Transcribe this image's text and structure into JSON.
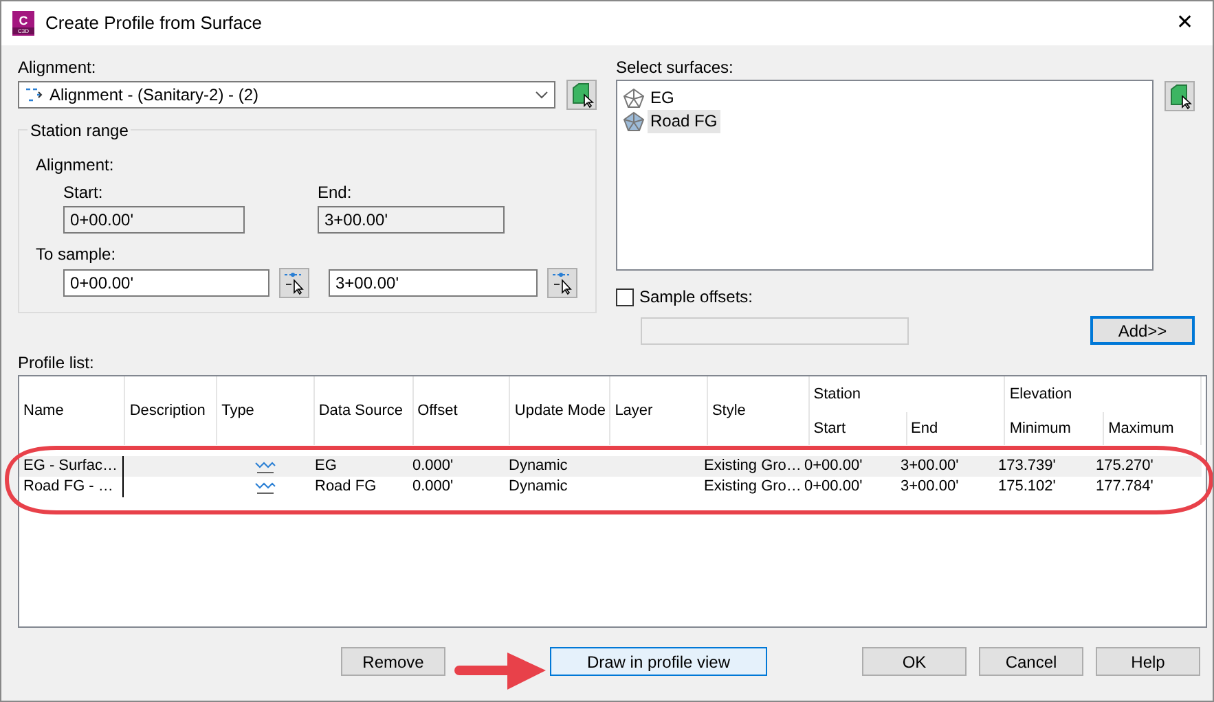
{
  "window": {
    "title": "Create Profile from Surface",
    "app_icon": {
      "letter": "C",
      "sub": "C3D"
    },
    "close": "✕"
  },
  "alignment": {
    "label": "Alignment:",
    "value": "Alignment - (Sanitary-2) - (2)"
  },
  "station_range": {
    "title": "Station range",
    "alignment_label": "Alignment:",
    "start_label": "Start:",
    "start": "0+00.00'",
    "end_label": "End:",
    "end": "3+00.00'",
    "sample_label": "To sample:",
    "sample_start": "0+00.00'",
    "sample_end": "3+00.00'"
  },
  "surfaces": {
    "label": "Select surfaces:",
    "items": [
      {
        "name": "EG",
        "selected": false
      },
      {
        "name": "Road FG",
        "selected": true
      }
    ]
  },
  "sample_offsets": {
    "label": "Sample offsets:",
    "checked": false
  },
  "add_button": {
    "label": "Add>>",
    "focused": true
  },
  "profile_list": {
    "label": "Profile list:",
    "columns": [
      "Name",
      "Description",
      "Type",
      "Data Source",
      "Offset",
      "Update Mode",
      "Layer",
      "Style"
    ],
    "groups": [
      {
        "label": "Station",
        "columns": [
          "Start",
          "End"
        ]
      },
      {
        "label": "Elevation",
        "columns": [
          "Minimum",
          "Maximum"
        ]
      }
    ],
    "rows": [
      {
        "selected": true,
        "cells": [
          "EG - Surfac…",
          "",
          "",
          "EG",
          "0.000'",
          "Dynamic",
          "",
          "Existing Gro…",
          "0+00.00'",
          "3+00.00'",
          "173.739'",
          "175.270'"
        ]
      },
      {
        "selected": false,
        "cells": [
          "Road FG - …",
          "",
          "",
          "Road FG",
          "0.000'",
          "Dynamic",
          "",
          "Existing Gro…",
          "0+00.00'",
          "3+00.00'",
          "175.102'",
          "177.784'"
        ]
      }
    ]
  },
  "buttons": [
    {
      "label": "Remove",
      "focused": false
    },
    {
      "label": "Draw in profile view",
      "focused": true
    },
    {
      "label": "OK",
      "focused": false
    },
    {
      "label": "Cancel",
      "focused": false
    },
    {
      "label": "Help",
      "focused": false
    }
  ]
}
